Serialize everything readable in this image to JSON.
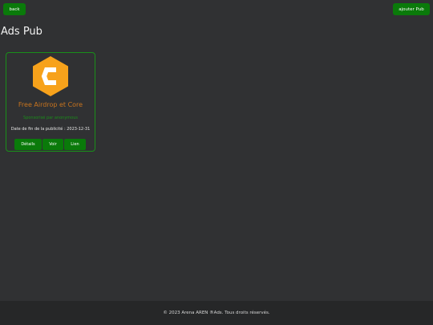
{
  "header": {
    "back_label": "back",
    "add_label": "ajouter Pub"
  },
  "page": {
    "title": "Ads Pub"
  },
  "cards": [
    {
      "title": "Free Airdrop et Core",
      "sponsor": "Sponsorisé par anonymous",
      "date": "Date de fin de la publicité : 2023-12-31",
      "logo_icon": "core-hexagon-logo",
      "logo_color": "#f7a21b",
      "actions": {
        "details": "Détails",
        "voir": "Voir",
        "lien": "Lien"
      }
    }
  ],
  "footer": {
    "text": "© 2023 Arena AREN ®Ads. Tous droits réservés."
  },
  "colors": {
    "background": "#303133",
    "accent_green": "#0a7a0a",
    "title_orange": "#c8741e"
  }
}
